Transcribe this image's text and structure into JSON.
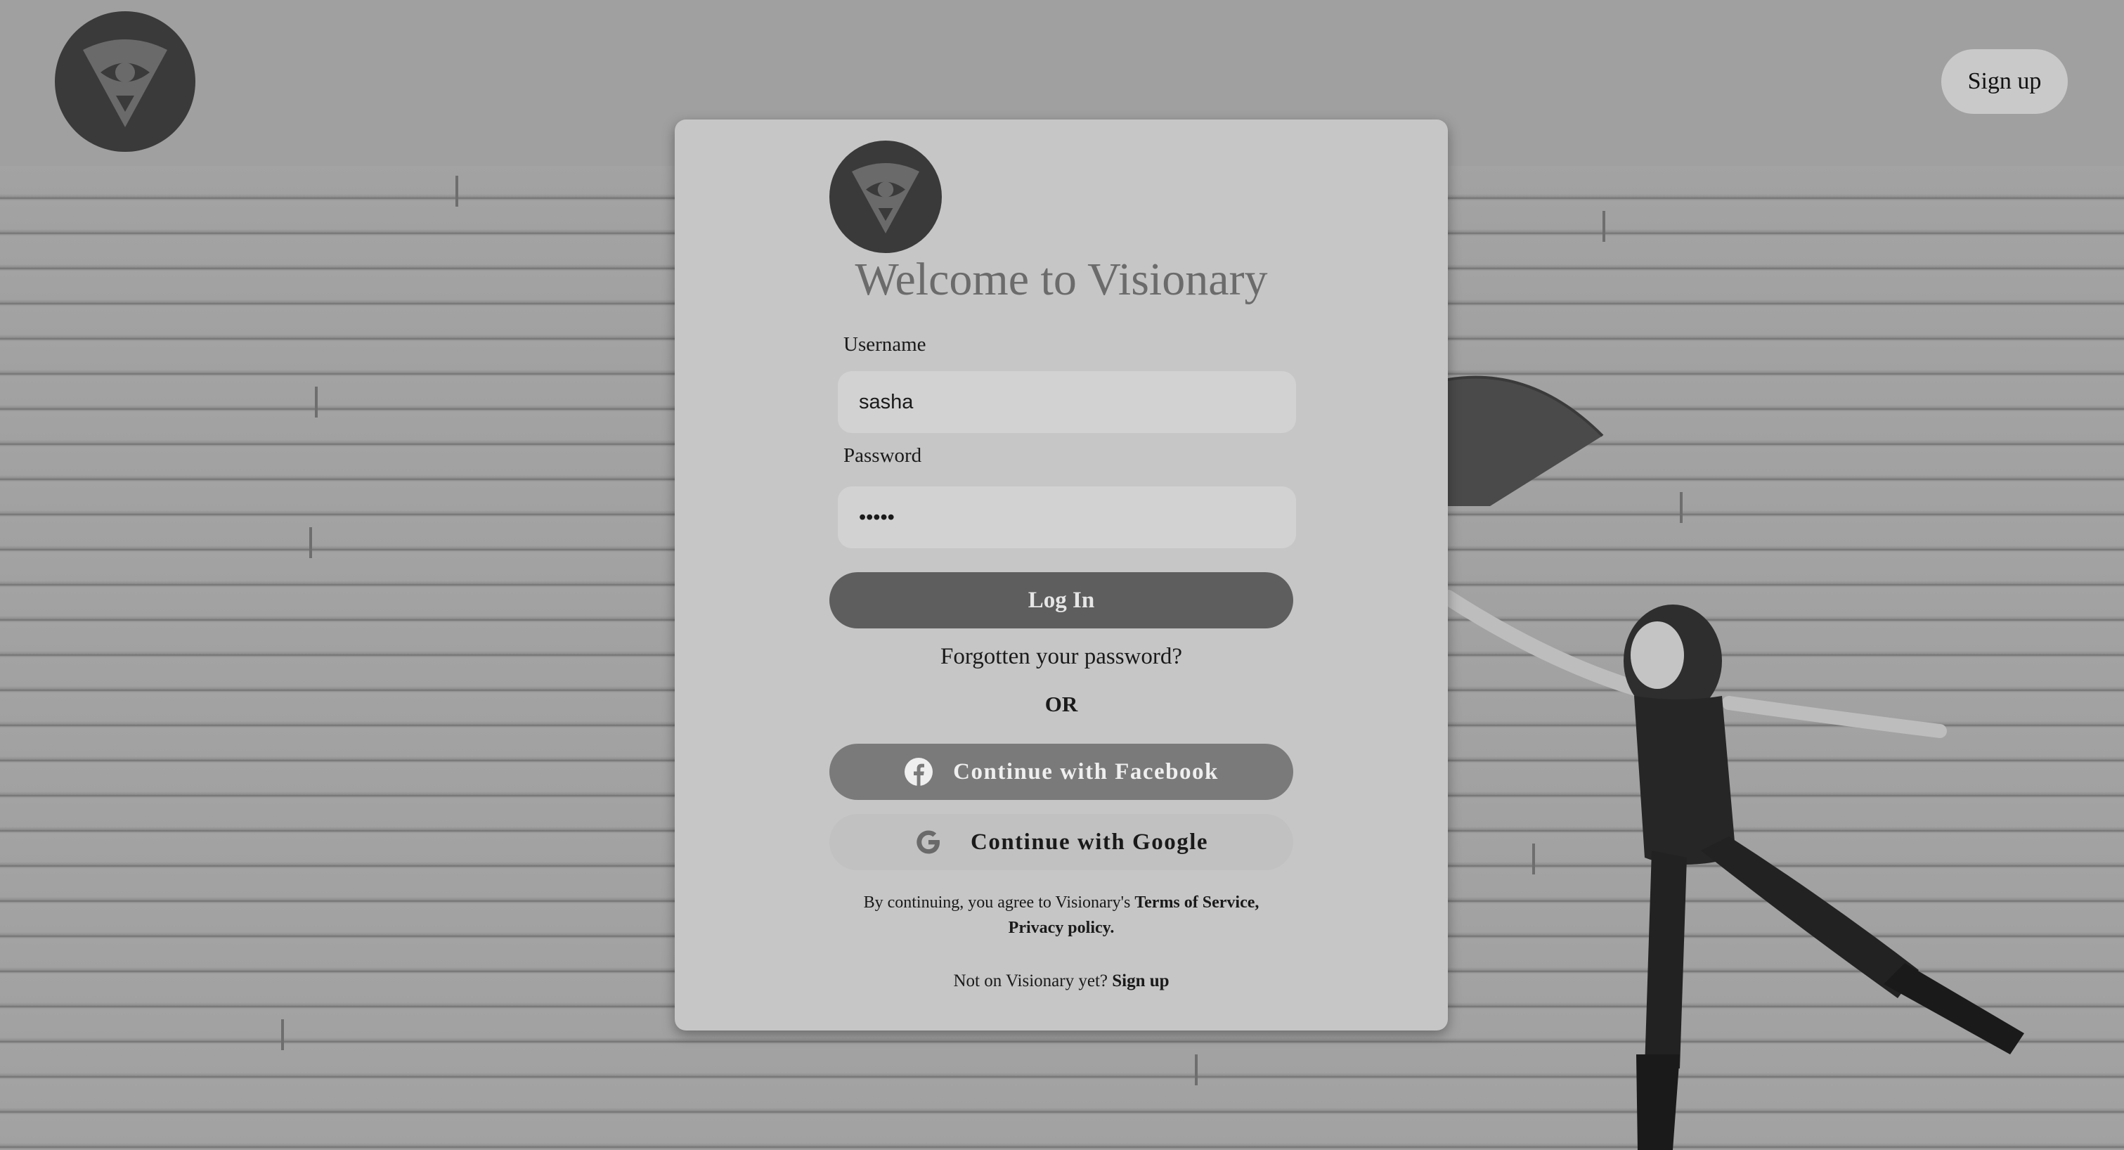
{
  "header": {
    "signup_label": "Sign up"
  },
  "login_card": {
    "title": "Welcome to Visionary",
    "username": {
      "label": "Username",
      "value": "sasha"
    },
    "password": {
      "label": "Password",
      "value": "•••••"
    },
    "login_label": "Log In",
    "forgot_label": "Forgotten your password?",
    "or_label": "OR",
    "facebook_label": "Continue with Facebook",
    "google_label": "Continue with Google",
    "terms": {
      "prefix": "By continuing, you agree to Visionary's",
      "terms_link": "Terms of Service,",
      "privacy_link": "Privacy policy."
    },
    "signup_prompt": {
      "text": "Not on Visionary yet?",
      "link": "Sign up"
    }
  },
  "icons": {
    "logo": "visionary-eye-logo-icon",
    "facebook": "facebook-icon",
    "google": "google-icon"
  },
  "colors": {
    "card_background": "#c6c6c6",
    "login_button": "#5e5e5e",
    "facebook_button": "#7a7a7a",
    "google_button": "#c1c1c1",
    "logo_background": "#3a3a3a"
  }
}
